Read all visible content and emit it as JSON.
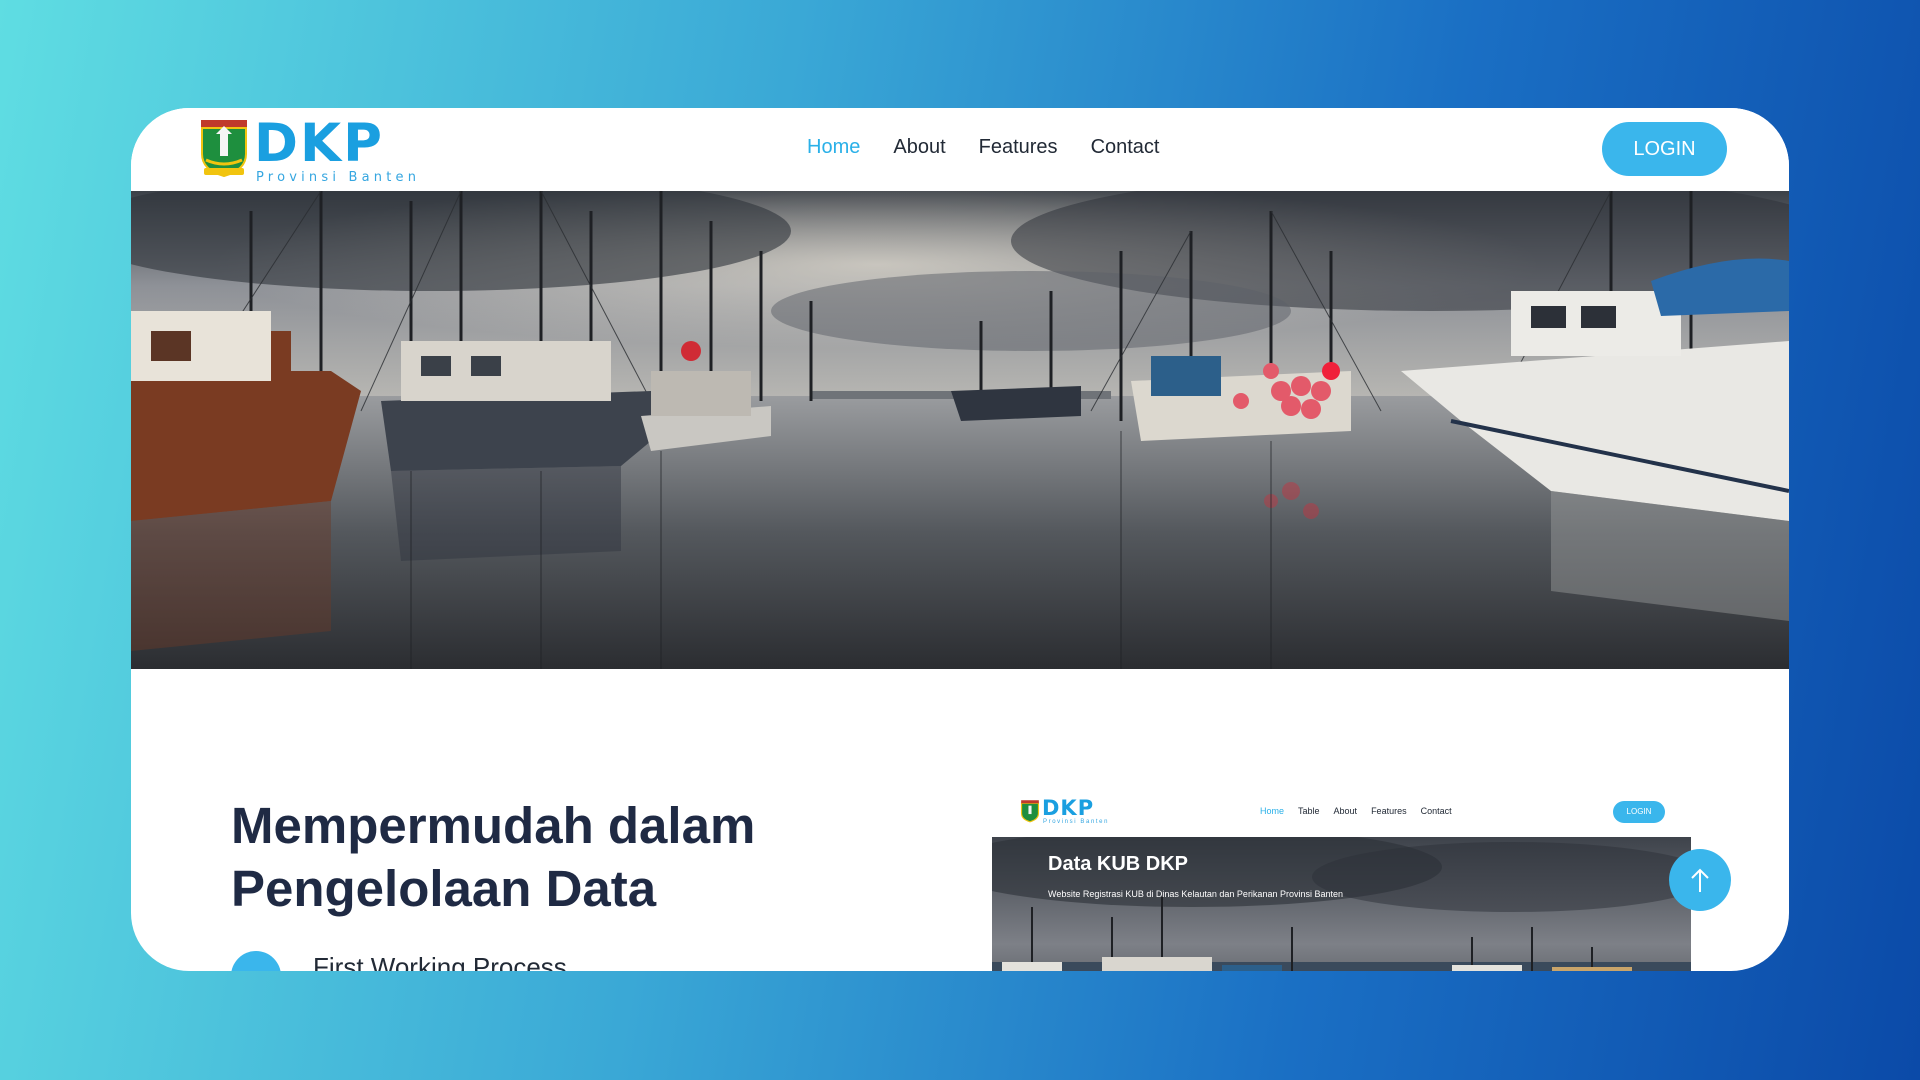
{
  "brand": {
    "name": "DKP",
    "subtitle": "Provinsi Banten"
  },
  "nav": {
    "items": [
      {
        "label": "Home",
        "active": true
      },
      {
        "label": "About",
        "active": false
      },
      {
        "label": "Features",
        "active": false
      },
      {
        "label": "Contact",
        "active": false
      }
    ],
    "login_label": "LOGIN"
  },
  "hero": {
    "image": "harbor-fishing-boats-photo"
  },
  "content": {
    "headline": "Mempermudah dalam Pengelolaan Data",
    "first_item": "First Working Process"
  },
  "preview": {
    "brand": "DKP",
    "brand_subtitle": "Provinsi Banten",
    "menu": [
      "Home",
      "Table",
      "About",
      "Features",
      "Contact"
    ],
    "login_label": "LOGIN",
    "hero_title": "Data KUB DKP",
    "hero_subtitle": "Website Registrasi KUB di Dinas Kelautan dan Perikanan Provinsi Banten"
  },
  "colors": {
    "accent": "#3ab6ec",
    "brand_blue": "#1a9fe0",
    "headline": "#1f2a44"
  },
  "icons": {
    "scroll_top": "arrow-up-icon"
  }
}
